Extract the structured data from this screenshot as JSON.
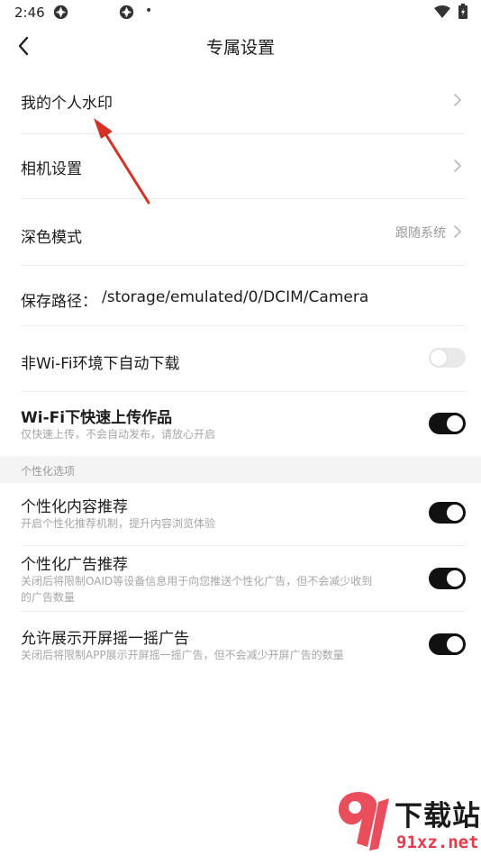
{
  "status_bar": {
    "time": "2:46",
    "dot": "•"
  },
  "header": {
    "title": "专属设置"
  },
  "rows": {
    "watermark": {
      "label": "我的个人水印"
    },
    "camera": {
      "label": "相机设置"
    },
    "dark_mode": {
      "label": "深色模式",
      "value": "跟随系统"
    },
    "save_path": {
      "label": "保存路径：",
      "value": "/storage/emulated/0/DCIM/Camera"
    },
    "non_wifi_download": {
      "label": "非Wi-Fi环境下自动下载",
      "enabled": false
    },
    "wifi_upload": {
      "label": "Wi-Fi下快速上传作品",
      "sub": "仅快速上传，不会自动发布，请放心开启",
      "enabled": true
    }
  },
  "section": {
    "title": "个性化选项"
  },
  "personal": {
    "content_rec": {
      "label": "个性化内容推荐",
      "sub": "开启个性化推荐机制，提升内容浏览体验",
      "enabled": true
    },
    "ad_rec": {
      "label": "个性化广告推荐",
      "sub_line1": "关闭后将限制OAID等设备信息用于向您推送个性化广告，但不会减少收到",
      "sub_line2": "的广告数量",
      "enabled": true
    },
    "shake_ad": {
      "label": "允许展示开屏摇一摇广告",
      "sub": "关闭后将限制APP展示开屏摇一摇广告，但不会减少开屏广告的数量",
      "enabled": true
    }
  },
  "watermark_logo": {
    "title": "下载站",
    "url": "91xz.net"
  },
  "colors": {
    "toggle_on": "#111111",
    "toggle_off": "#e9e9e9",
    "arrow": "#d93025",
    "watermark_red": "#e83a4a"
  }
}
